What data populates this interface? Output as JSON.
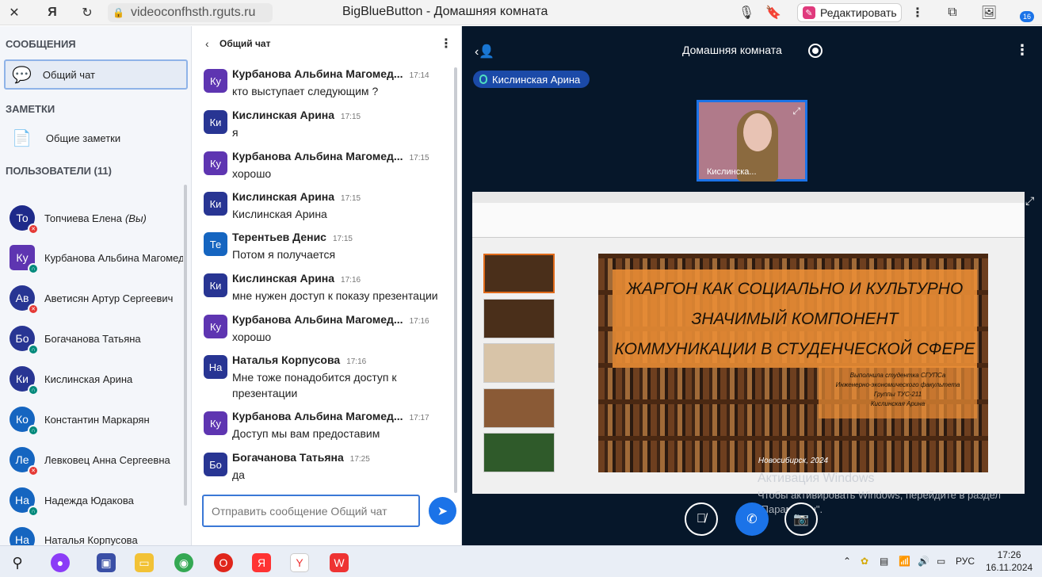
{
  "browser": {
    "url": "videoconfhsth.rguts.ru",
    "page_title": "BigBlueButton - Домашняя комната",
    "edit_label": "Редактировать",
    "ext_badge": "16"
  },
  "sidebar": {
    "messages_title": "СООБЩЕНИЯ",
    "public_chat": "Общий чат",
    "notes_title": "ЗАМЕТКИ",
    "shared_notes": "Общие заметки",
    "users_title": "ПОЛЬЗОВАТЕЛИ (11)",
    "users": [
      {
        "initials": "То",
        "name": "Топчиева Елена",
        "suffix": "(Вы)",
        "color": "#1e2a8a",
        "audio": "muted"
      },
      {
        "initials": "Ку",
        "name": "Курбанова Альбина Магомедовна",
        "suffix": "",
        "color": "#5e35b1",
        "audio": "listen"
      },
      {
        "initials": "Ав",
        "name": "Аветисян Артур Сергеевич",
        "suffix": "",
        "color": "#283593",
        "audio": "muted"
      },
      {
        "initials": "Бо",
        "name": "Богачанова Татьяна",
        "suffix": "",
        "color": "#283593",
        "audio": "listen"
      },
      {
        "initials": "Ки",
        "name": "Кислинская Арина",
        "suffix": "",
        "color": "#283593",
        "audio": "listen"
      },
      {
        "initials": "Ко",
        "name": "Константин Маркарян",
        "suffix": "",
        "color": "#1565c0",
        "audio": "listen"
      },
      {
        "initials": "Ле",
        "name": "Левковец Анна Сергеевна",
        "suffix": "",
        "color": "#1565c0",
        "audio": "muted"
      },
      {
        "initials": "На",
        "name": "Надежда Юдакова",
        "suffix": "",
        "color": "#1565c0",
        "audio": "listen"
      },
      {
        "initials": "На",
        "name": "Наталья Корпусова",
        "suffix": "",
        "color": "#1565c0",
        "audio": "muted"
      }
    ]
  },
  "chat": {
    "header_title": "Общий чат",
    "input_placeholder": "Отправить сообщение Общий чат",
    "messages": [
      {
        "initials": "Ку",
        "color": "#5e35b1",
        "name": "Курбанова Альбина Магомед...",
        "time": "17:14",
        "text": "кто выступает следующим ?"
      },
      {
        "initials": "Ки",
        "color": "#283593",
        "name": "Кислинская Арина",
        "time": "17:15",
        "text": "я"
      },
      {
        "initials": "Ку",
        "color": "#5e35b1",
        "name": "Курбанова Альбина Магомед...",
        "time": "17:15",
        "text": "хорошо"
      },
      {
        "initials": "Ки",
        "color": "#283593",
        "name": "Кислинская Арина",
        "time": "17:15",
        "text": "Кислинская Арина"
      },
      {
        "initials": "Те",
        "color": "#1565c0",
        "name": "Терентьев Денис",
        "time": "17:15",
        "text": "Потом я получается"
      },
      {
        "initials": "Ки",
        "color": "#283593",
        "name": "Кислинская Арина",
        "time": "17:16",
        "text": "мне нужен доступ к показу презентации"
      },
      {
        "initials": "Ку",
        "color": "#5e35b1",
        "name": "Курбанова Альбина Магомед...",
        "time": "17:16",
        "text": "хорошо"
      },
      {
        "initials": "На",
        "color": "#283593",
        "name": "Наталья Корпусова",
        "time": "17:16",
        "text": "Мне тоже понадобится доступ к презентации"
      },
      {
        "initials": "Ку",
        "color": "#5e35b1",
        "name": "Курбанова Альбина Магомед...",
        "time": "17:17",
        "text": "Доступ мы вам предоставим"
      },
      {
        "initials": "Бо",
        "color": "#283593",
        "name": "Богачанова Татьяна",
        "time": "17:25",
        "text": "да"
      }
    ]
  },
  "main": {
    "room_title": "Домашняя комната",
    "talking_user": "Кислинская Арина",
    "webcam_name": "Кислинска...",
    "slide": {
      "title_lines": [
        "ЖАРГОН КАК СОЦИАЛЬНО И КУЛЬТУРНО",
        "ЗНАЧИМЫЙ КОМПОНЕНТ",
        "КОММУНИКАЦИИ В СТУДЕНЧЕСКОЙ СФЕРЕ"
      ],
      "subtitle_lines": [
        "Выполнила студентка СГУПСа",
        "Инженерно-экономического факультета",
        "Группы ТУС-211",
        "Кислинская Арина"
      ],
      "city": "Новосибирск, 2024"
    },
    "activation_title": "Активация Windows",
    "activation_text": "Чтобы активировать Windows, перейдите в раздел \"Параметры\"."
  },
  "taskbar": {
    "lang": "РУС",
    "time": "17:26",
    "date": "16.11.2024"
  }
}
